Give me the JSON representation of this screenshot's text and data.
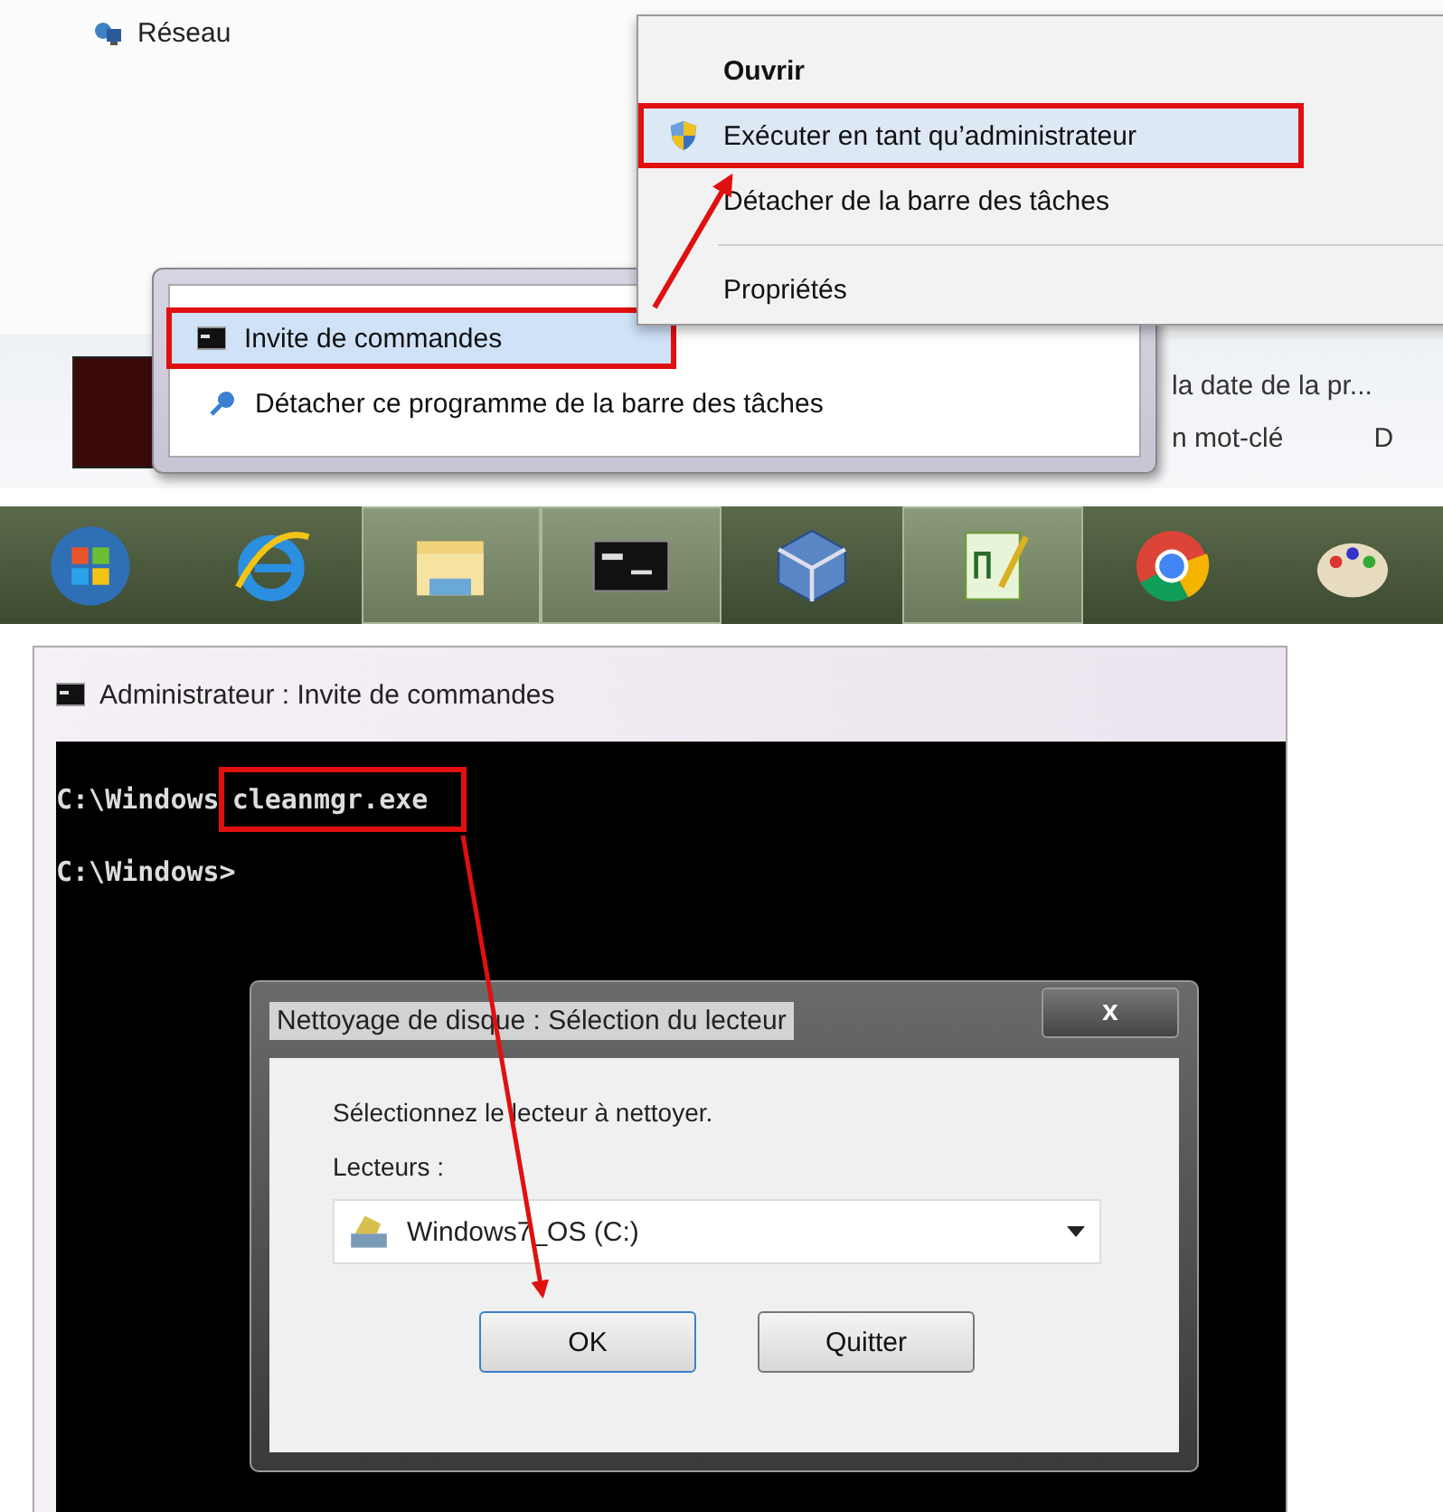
{
  "start_menu": {
    "network_item": {
      "label": "Réseau"
    },
    "behind_texts": [
      "la date de la pr...",
      "n mot-clé",
      "D"
    ]
  },
  "context_menu": {
    "items": [
      {
        "label": "Ouvrir",
        "kind": "default",
        "selected": false,
        "highlighted": false
      },
      {
        "label": "Exécuter en tant qu’administrateur",
        "kind": "shield",
        "selected": true,
        "highlighted": true
      },
      {
        "label": "Détacher de la barre des tâches",
        "kind": "plain",
        "selected": false,
        "highlighted": false
      },
      {
        "label": "Propriétés",
        "kind": "plain",
        "selected": false,
        "highlighted": false
      }
    ]
  },
  "jump_list": {
    "items": [
      {
        "label": "Invite de commandes",
        "kind": "cmd",
        "selected": true,
        "highlighted": true
      },
      {
        "label": "Détacher ce programme de la barre des tâches",
        "kind": "pin",
        "selected": false,
        "highlighted": false
      }
    ]
  },
  "taskbar": {
    "items": [
      {
        "kind": "start",
        "active": false
      },
      {
        "kind": "ie",
        "active": false
      },
      {
        "kind": "folder",
        "active": true
      },
      {
        "kind": "cmd",
        "active": true
      },
      {
        "kind": "cube",
        "active": false
      },
      {
        "kind": "editor",
        "active": true
      },
      {
        "kind": "chrome",
        "active": false
      },
      {
        "kind": "palette",
        "active": false
      }
    ]
  },
  "console_window": {
    "title": "Administrateur : Invite de commandes",
    "lines": [
      {
        "prompt": "C:\\Windows",
        "command": "cleanmgr.exe",
        "highlighted": true
      },
      {
        "prompt": "C:\\Windows>"
      }
    ]
  },
  "dialog": {
    "title": "Nettoyage de disque : Sélection du lecteur",
    "close": "x",
    "instruction": "Sélectionnez le lecteur à nettoyer.",
    "drives_label": "Lecteurs :",
    "drive_value": "Windows7_OS (C:)",
    "buttons": [
      {
        "label": "OK",
        "kind": "default"
      },
      {
        "label": "Quitter",
        "kind": "normal"
      }
    ]
  }
}
